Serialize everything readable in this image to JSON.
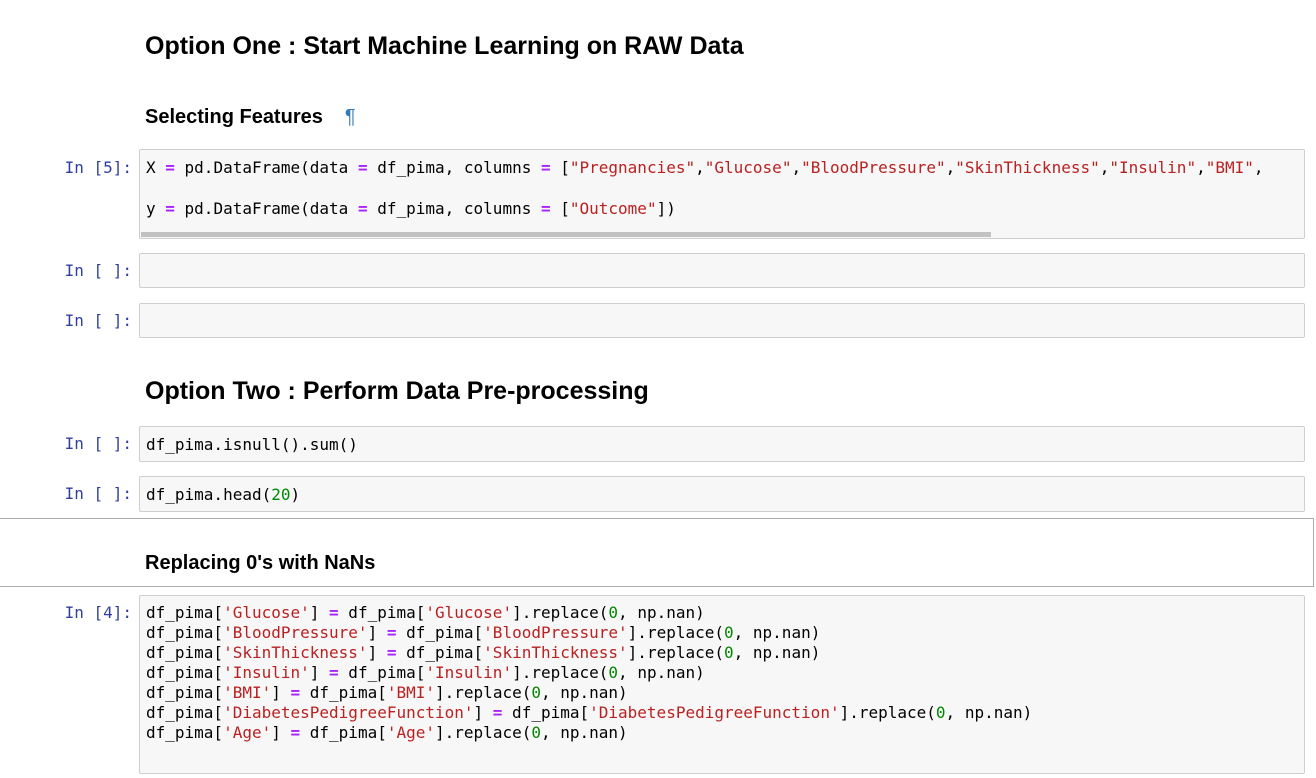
{
  "headings": {
    "option_one": "Option One : Start Machine Learning on RAW Data",
    "selecting_features": "Selecting Features",
    "pilcrow": "¶",
    "option_two": "Option Two : Perform Data Pre-processing",
    "replacing": "Replacing 0's with NaNs"
  },
  "cells": [
    {
      "prompt": "In [5]:",
      "lines": [
        [
          [
            "X ",
            ""
          ],
          [
            "=",
            "kw"
          ],
          [
            " pd.DataFrame(data ",
            ""
          ],
          [
            "=",
            "kw"
          ],
          [
            " df_pima, columns ",
            ""
          ],
          [
            "=",
            "kw"
          ],
          [
            " [",
            ""
          ],
          [
            "\"Pregnancies\"",
            "st"
          ],
          [
            ",",
            ""
          ],
          [
            "\"Glucose\"",
            "st"
          ],
          [
            ",",
            ""
          ],
          [
            "\"BloodPressure\"",
            "st"
          ],
          [
            ",",
            ""
          ],
          [
            "\"SkinThickness\"",
            "st"
          ],
          [
            ",",
            ""
          ],
          [
            "\"Insulin\"",
            "st"
          ],
          [
            ",",
            ""
          ],
          [
            "\"BMI\"",
            "st"
          ],
          [
            ",",
            ""
          ]
        ],
        [],
        [
          [
            "y ",
            ""
          ],
          [
            "=",
            "kw"
          ],
          [
            " pd.DataFrame(data ",
            ""
          ],
          [
            "=",
            "kw"
          ],
          [
            " df_pima, columns ",
            ""
          ],
          [
            "=",
            "kw"
          ],
          [
            " [",
            ""
          ],
          [
            "\"Outcome\"",
            "st"
          ],
          [
            "])",
            ""
          ]
        ]
      ]
    },
    {
      "prompt": "In [ ]:",
      "lines": []
    },
    {
      "prompt": "In [ ]:",
      "lines": []
    },
    {
      "prompt": "In [ ]:",
      "lines": [
        [
          [
            "df_pima.isnull().sum()",
            ""
          ]
        ]
      ]
    },
    {
      "prompt": "In [ ]:",
      "lines": [
        [
          [
            "df_pima.head(",
            ""
          ],
          [
            "20",
            "nm"
          ],
          [
            ")",
            ""
          ]
        ]
      ]
    },
    {
      "prompt": "In [4]:",
      "lines": [
        [
          [
            "df_pima[",
            ""
          ],
          [
            "'Glucose'",
            "st"
          ],
          [
            "] ",
            ""
          ],
          [
            "=",
            "kw"
          ],
          [
            " df_pima[",
            ""
          ],
          [
            "'Glucose'",
            "st"
          ],
          [
            "].replace(",
            ""
          ],
          [
            "0",
            "nm"
          ],
          [
            ", np.nan)",
            ""
          ]
        ],
        [
          [
            "df_pima[",
            ""
          ],
          [
            "'BloodPressure'",
            "st"
          ],
          [
            "] ",
            ""
          ],
          [
            "=",
            "kw"
          ],
          [
            " df_pima[",
            ""
          ],
          [
            "'BloodPressure'",
            "st"
          ],
          [
            "].replace(",
            ""
          ],
          [
            "0",
            "nm"
          ],
          [
            ", np.nan)",
            ""
          ]
        ],
        [
          [
            "df_pima[",
            ""
          ],
          [
            "'SkinThickness'",
            "st"
          ],
          [
            "] ",
            ""
          ],
          [
            "=",
            "kw"
          ],
          [
            " df_pima[",
            ""
          ],
          [
            "'SkinThickness'",
            "st"
          ],
          [
            "].replace(",
            ""
          ],
          [
            "0",
            "nm"
          ],
          [
            ", np.nan)",
            ""
          ]
        ],
        [
          [
            "df_pima[",
            ""
          ],
          [
            "'Insulin'",
            "st"
          ],
          [
            "] ",
            ""
          ],
          [
            "=",
            "kw"
          ],
          [
            " df_pima[",
            ""
          ],
          [
            "'Insulin'",
            "st"
          ],
          [
            "].replace(",
            ""
          ],
          [
            "0",
            "nm"
          ],
          [
            ", np.nan)",
            ""
          ]
        ],
        [
          [
            "df_pima[",
            ""
          ],
          [
            "'BMI'",
            "st"
          ],
          [
            "] ",
            ""
          ],
          [
            "=",
            "kw"
          ],
          [
            " df_pima[",
            ""
          ],
          [
            "'BMI'",
            "st"
          ],
          [
            "].replace(",
            ""
          ],
          [
            "0",
            "nm"
          ],
          [
            ", np.nan)",
            ""
          ]
        ],
        [
          [
            "df_pima[",
            ""
          ],
          [
            "'DiabetesPedigreeFunction'",
            "st"
          ],
          [
            "] ",
            ""
          ],
          [
            "=",
            "kw"
          ],
          [
            " df_pima[",
            ""
          ],
          [
            "'DiabetesPedigreeFunction'",
            "st"
          ],
          [
            "].replace(",
            ""
          ],
          [
            "0",
            "nm"
          ],
          [
            ", np.nan)",
            ""
          ]
        ],
        [
          [
            "df_pima[",
            ""
          ],
          [
            "'Age'",
            "st"
          ],
          [
            "] ",
            ""
          ],
          [
            "=",
            "kw"
          ],
          [
            " df_pima[",
            ""
          ],
          [
            "'Age'",
            "st"
          ],
          [
            "].replace(",
            ""
          ],
          [
            "0",
            "nm"
          ],
          [
            ", np.nan)",
            ""
          ]
        ]
      ]
    }
  ]
}
